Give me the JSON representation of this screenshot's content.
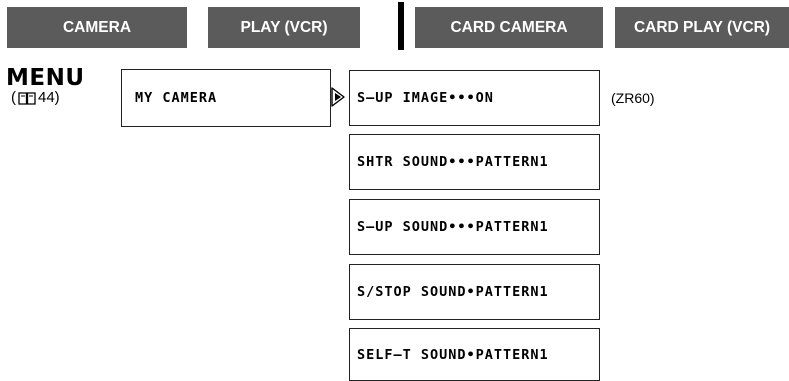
{
  "tabs": {
    "camera": "CAMERA",
    "play_vcr": "PLAY (VCR)",
    "card_camera": "CARD CAMERA",
    "card_play_vcr": "CARD PLAY (VCR)"
  },
  "menu": {
    "title": "MENU",
    "ref_open": "(",
    "ref_page": "44)"
  },
  "main_item": "MY CAMERA",
  "submenu": [
    "S–UP IMAGE•••ON",
    "SHTR SOUND•••PATTERN1",
    "S–UP SOUND•••PATTERN1",
    "S/STOP SOUND•PATTERN1",
    "SELF–T SOUND•PATTERN1"
  ],
  "model_note": "(ZR60)",
  "colors": {
    "tab_bg": "#5b5b5b",
    "tab_text": "#ffffff"
  }
}
